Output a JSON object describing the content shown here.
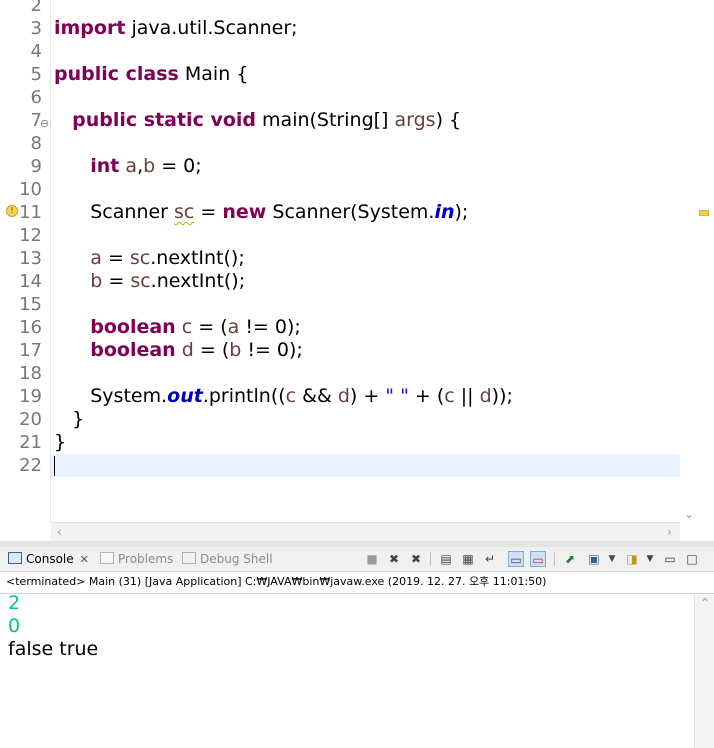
{
  "editor": {
    "line_numbers": [
      "2",
      "3",
      "4",
      "5",
      "6",
      "7",
      "8",
      "9",
      "10",
      "11",
      "12",
      "13",
      "14",
      "15",
      "16",
      "17",
      "18",
      "19",
      "20",
      "21",
      "22"
    ],
    "code": {
      "l3_kw": "import",
      "l3_rest": " java.util.Scanner;",
      "l5_kw": "public class",
      "l5_rest": " Main {",
      "l7_indent": "   ",
      "l7_kw": "public static void",
      "l7_a": " main(String[] ",
      "l7_var": "args",
      "l7_b": ") {",
      "l9_indent": "      ",
      "l9_kw": "int",
      "l9_a": " ",
      "l9_var1": "a",
      "l9_b": ",",
      "l9_var2": "b",
      "l9_c": " = 0;",
      "l11_indent": "      ",
      "l11_a": "Scanner ",
      "l11_var": "sc",
      "l11_b": " = ",
      "l11_kw": "new",
      "l11_c": " Scanner(System.",
      "l11_fld": "in",
      "l11_d": ");",
      "l13_indent": "      ",
      "l13_var1": "a",
      "l13_a": " = ",
      "l13_var2": "sc",
      "l13_b": ".nextInt();",
      "l14_indent": "      ",
      "l14_var1": "b",
      "l14_a": " = ",
      "l14_var2": "sc",
      "l14_b": ".nextInt();",
      "l16_indent": "      ",
      "l16_kw": "boolean",
      "l16_a": " ",
      "l16_var1": "c",
      "l16_b": " = (",
      "l16_var2": "a",
      "l16_c": " != 0);",
      "l17_indent": "      ",
      "l17_kw": "boolean",
      "l17_a": " ",
      "l17_var1": "d",
      "l17_b": " = (",
      "l17_var2": "b",
      "l17_c": " != 0);",
      "l19_indent": "      ",
      "l19_a": "System.",
      "l19_fld": "out",
      "l19_b": ".println((",
      "l19_var1": "c",
      "l19_c": " && ",
      "l19_var2": "d",
      "l19_d": ") + ",
      "l19_str": "\" \"",
      "l19_e": " + (",
      "l19_var3": "c",
      "l19_f": " || ",
      "l19_var4": "d",
      "l19_g": "));",
      "l20": "   }",
      "l21": "}"
    },
    "colors": {
      "keyword": "#7f0055",
      "local_variable": "#6a3e3e",
      "static_field": "#0000c0",
      "string": "#2a00ff",
      "current_line_highlight": "#e8f2fe"
    }
  },
  "console_view": {
    "tabs": [
      {
        "label": "Console",
        "icon": "console-icon",
        "active": true,
        "close": "✕"
      },
      {
        "label": "Problems",
        "icon": "problems-icon",
        "active": false
      },
      {
        "label": "Debug Shell",
        "icon": "debug-shell-icon",
        "active": false
      }
    ],
    "toolbar_icons": [
      "terminate-icon",
      "remove-launch-icon",
      "remove-all-terminated-icon",
      "clear-console-icon",
      "scroll-lock-icon",
      "word-wrap-icon",
      "show-on-stdout-icon",
      "show-on-stderr-icon",
      "pin-console-icon",
      "display-console-icon",
      "dropdown-icon",
      "open-console-icon",
      "dropdown-icon",
      "minimize-icon",
      "maximize-icon"
    ],
    "status": "<terminated> Main (31) [Java Application] C:₩JAVA₩bin₩javaw.exe (2019. 12. 27. 오후 11:01:50)",
    "output": [
      {
        "text": "2",
        "kind": "input"
      },
      {
        "text": "0",
        "kind": "input"
      },
      {
        "text": "false true",
        "kind": "stdout"
      }
    ],
    "colors": {
      "stdin": "#00c87f",
      "stdout": "#000000"
    }
  }
}
